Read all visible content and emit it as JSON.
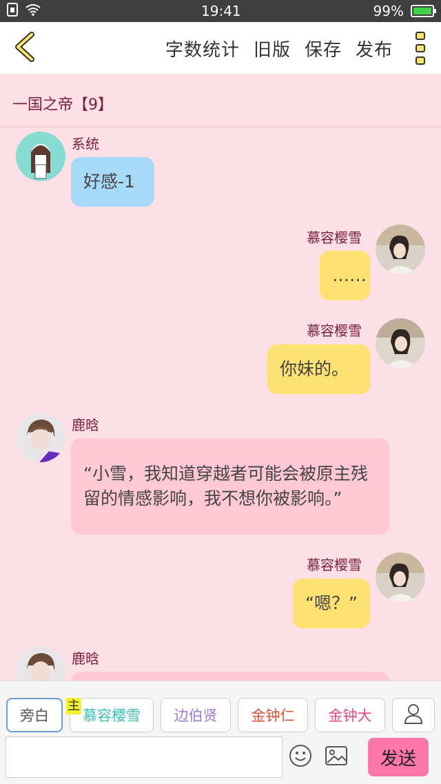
{
  "status_bar": {
    "time": "19:41",
    "battery": "99%"
  },
  "top_bar": {
    "actions": [
      "字数统计",
      "旧版",
      "保存",
      "发布"
    ]
  },
  "chapter": {
    "title": "一国之帝【9】"
  },
  "messages": [
    {
      "sender": "系统",
      "text": "好感-1",
      "side": "left"
    },
    {
      "sender": "慕容樱雪",
      "text": "……",
      "side": "right"
    },
    {
      "sender": "慕容樱雪",
      "text": "你妹的。",
      "side": "right"
    },
    {
      "sender": "鹿晗",
      "text": "“小雪，我知道穿越者可能会被原主残留的情感影响，我不想你被影响。”",
      "side": "left"
    },
    {
      "sender": "慕容樱雪",
      "text": "“嗯？”",
      "side": "right"
    },
    {
      "sender": "鹿晗",
      "text": "",
      "side": "left"
    }
  ],
  "roles": [
    {
      "label": "旁白",
      "color": "#555555"
    },
    {
      "label": "慕容樱雪",
      "color": "#3bbfb4",
      "tag": "主"
    },
    {
      "label": "边伯贤",
      "color": "#a07ad6"
    },
    {
      "label": "金钟仁",
      "color": "#d9533a"
    },
    {
      "label": "金钟大",
      "color": "#e04a8a"
    }
  ],
  "composer": {
    "input_value": "",
    "send_label": "发送"
  },
  "colors": {
    "bg": "#fde0e6",
    "bubble_blue": "#a6daf8",
    "bubble_yellow": "#fde273",
    "bubble_pink": "#fec9d5",
    "send": "#ff77a8"
  },
  "icons": [
    "back-chevron-icon",
    "more-dots-icon",
    "user-icon",
    "emoji-icon",
    "image-icon",
    "wifi-icon",
    "sim-icon"
  ]
}
